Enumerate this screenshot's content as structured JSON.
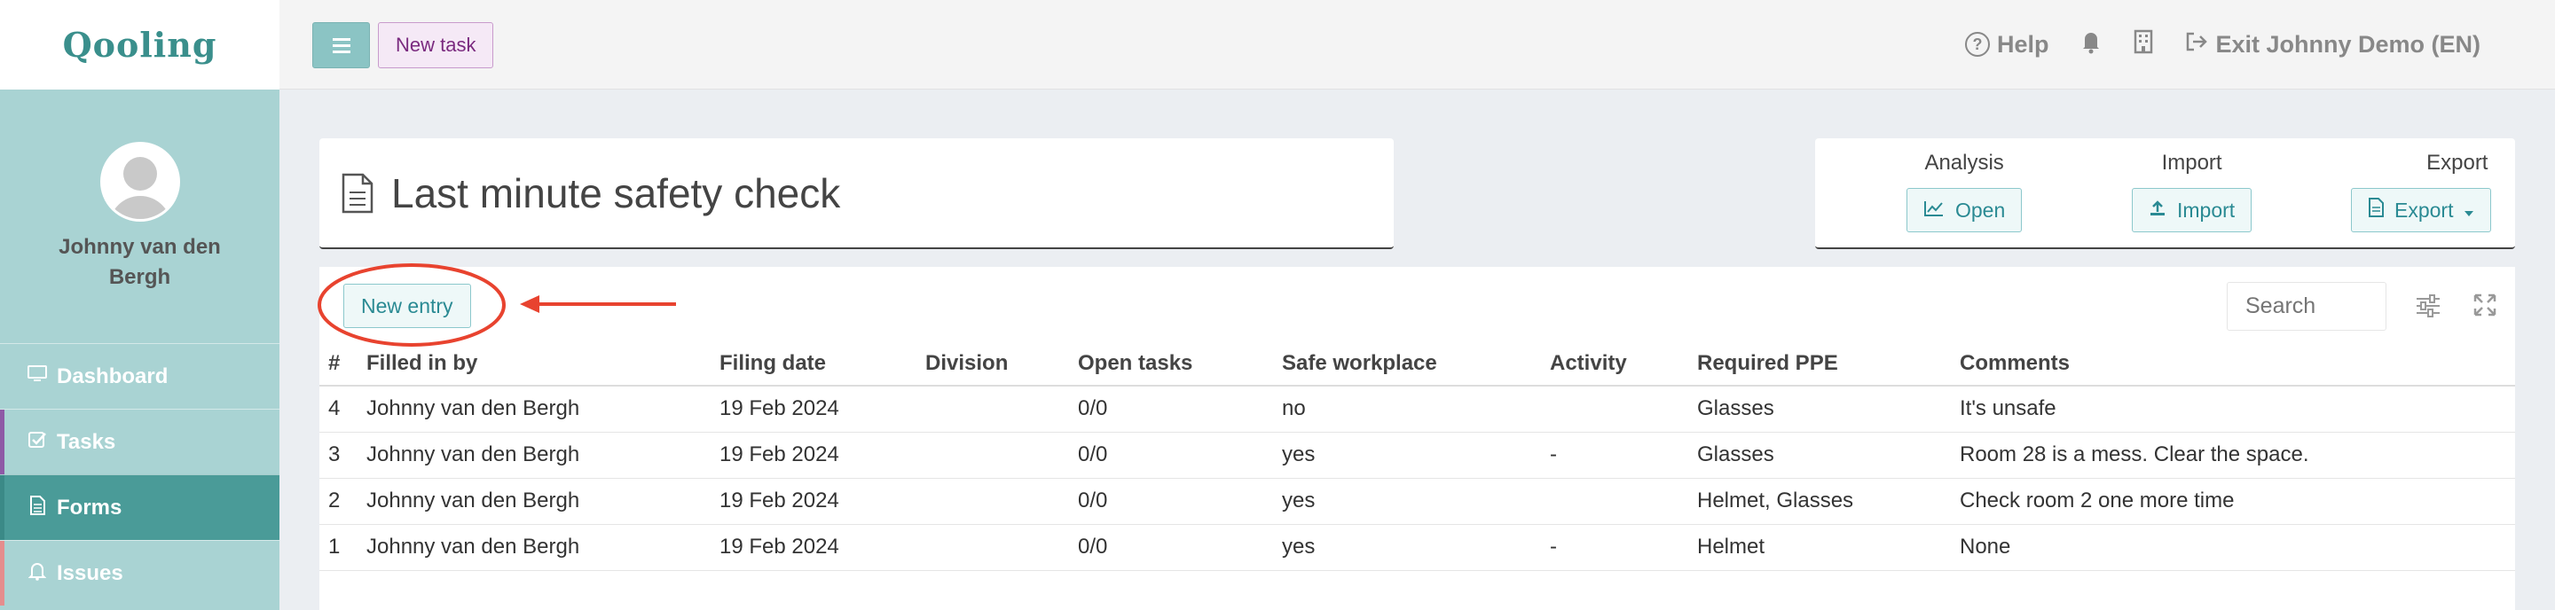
{
  "app": {
    "logo": "Qooling"
  },
  "user": {
    "name": "Johnny van den Bergh"
  },
  "sidebar": {
    "items": [
      {
        "label": "Dashboard",
        "icon": "monitor-icon",
        "stripe": "#a9d3d3",
        "active": false
      },
      {
        "label": "Tasks",
        "icon": "checkbox-icon",
        "stripe": "#8e5aa6",
        "active": false
      },
      {
        "label": "Forms",
        "icon": "document-icon",
        "stripe": "#4a9b98",
        "active": true
      },
      {
        "label": "Issues",
        "icon": "bell-icon",
        "stripe": "#e58d8d",
        "active": false
      }
    ]
  },
  "topbar": {
    "new_task_label": "New task",
    "help_label": "Help",
    "exit_label": "Exit Johnny Demo (EN)"
  },
  "form": {
    "title": "Last minute safety check"
  },
  "actions": {
    "analysis_label": "Analysis",
    "open_label": "Open",
    "import_label": "Import",
    "import_button_label": "Import",
    "export_label": "Export",
    "export_button_label": "Export"
  },
  "table": {
    "new_entry_label": "New entry",
    "search_placeholder": "Search",
    "columns": [
      "#",
      "Filled in by",
      "Filing date",
      "Division",
      "Open tasks",
      "Safe workplace",
      "Activity",
      "Required PPE",
      "Comments"
    ],
    "rows": [
      [
        "4",
        "Johnny van den Bergh",
        "19 Feb 2024",
        "",
        "0/0",
        "no",
        "",
        "Glasses",
        "It's unsafe"
      ],
      [
        "3",
        "Johnny van den Bergh",
        "19 Feb 2024",
        "",
        "0/0",
        "yes",
        "-",
        "Glasses",
        "Room 28 is a mess. Clear the space."
      ],
      [
        "2",
        "Johnny van den Bergh",
        "19 Feb 2024",
        "",
        "0/0",
        "yes",
        "",
        "Helmet, Glasses",
        "Check room 2 one more time"
      ],
      [
        "1",
        "Johnny van den Bergh",
        "19 Feb 2024",
        "",
        "0/0",
        "yes",
        "-",
        "Helmet",
        "None"
      ]
    ]
  },
  "colors": {
    "accent": "#4a9b98",
    "annotation": "#e8432f"
  }
}
